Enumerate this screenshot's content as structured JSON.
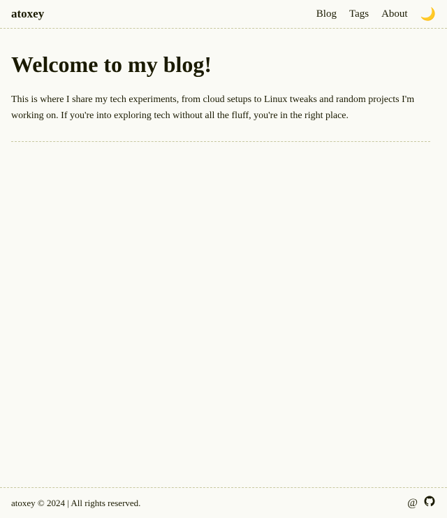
{
  "header": {
    "site_title": "atoxey",
    "nav": {
      "blog_label": "Blog",
      "tags_label": "Tags",
      "about_label": "About"
    },
    "theme_toggle_icon": "🌙"
  },
  "main": {
    "heading": "Welcome to my blog!",
    "description": "This is where I share my tech experiments, from cloud setups to Linux tweaks and random projects I'm working on. If you're into exploring tech without all the fluff, you're in the right place."
  },
  "footer": {
    "copyright": "atoxey © 2024  |  All rights reserved.",
    "email_icon": "@",
    "github_icon": "⊙"
  }
}
